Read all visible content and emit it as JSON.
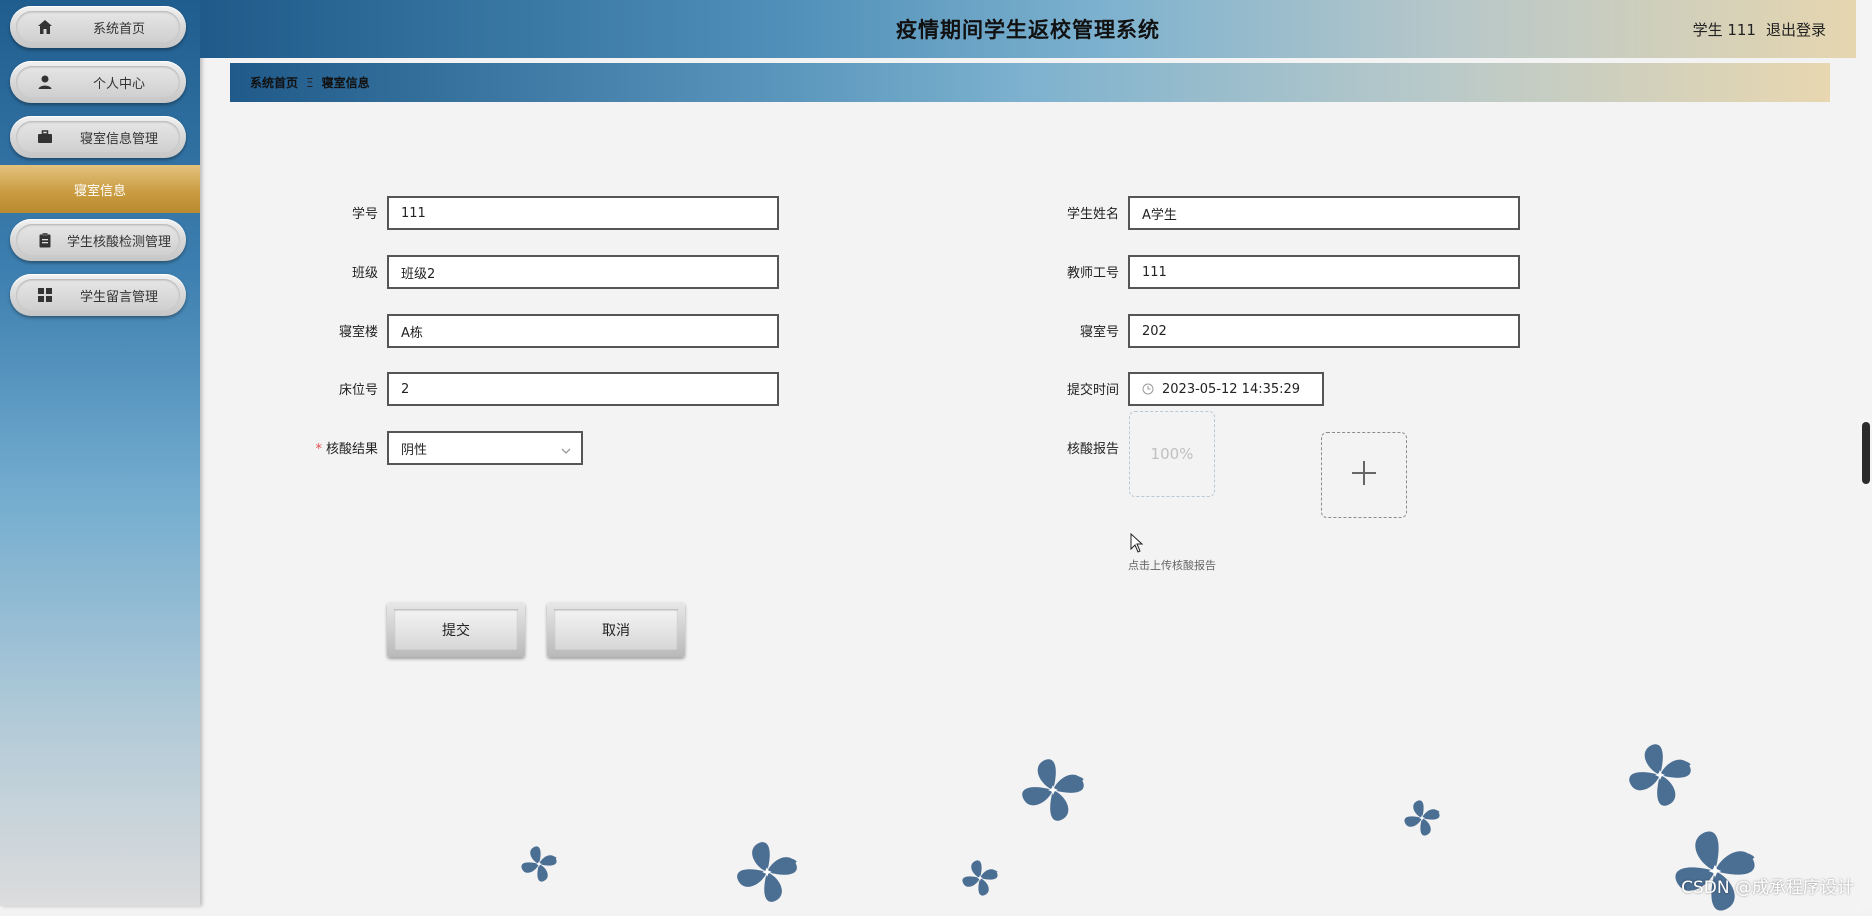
{
  "app": {
    "title": "疫情期间学生返校管理系统"
  },
  "header": {
    "user_label": "学生 111",
    "logout_label": "退出登录"
  },
  "sidebar": {
    "items": [
      {
        "label": "系统首页",
        "icon": "home-icon"
      },
      {
        "label": "个人中心",
        "icon": "user-icon"
      },
      {
        "label": "寝室信息管理",
        "icon": "briefcase-icon"
      },
      {
        "label": "学生核酸检测管理",
        "icon": "clipboard-icon"
      },
      {
        "label": "学生留言管理",
        "icon": "grid-icon"
      }
    ],
    "submenu_active": "寝室信息"
  },
  "breadcrumb": {
    "home": "系统首页",
    "separator": "Ξ",
    "current": "寝室信息"
  },
  "form": {
    "student_id": {
      "label": "学号",
      "value": "111"
    },
    "student_name": {
      "label": "学生姓名",
      "value": "A学生"
    },
    "class": {
      "label": "班级",
      "value": "班级2"
    },
    "teacher_id": {
      "label": "教师工号",
      "value": "111"
    },
    "building": {
      "label": "寝室楼",
      "value": "A栋"
    },
    "room_no": {
      "label": "寝室号",
      "value": "202"
    },
    "bed_no": {
      "label": "床位号",
      "value": "2"
    },
    "submit_time": {
      "label": "提交时间",
      "value": "2023-05-12 14:35:29"
    },
    "test_result": {
      "label": "核酸结果",
      "required_mark": "*",
      "value": "阴性"
    },
    "report": {
      "label": "核酸报告",
      "progress": "100%",
      "progress_value": 1.0,
      "hint": "点击上传核酸报告"
    }
  },
  "buttons": {
    "submit": "提交",
    "cancel": "取消"
  },
  "watermark": "CSDN @成承程序设计",
  "colors": {
    "accent_gold": "#c99a3e",
    "header_blue": "#1f5a8a",
    "required": "#e04c4c",
    "flower": "#4b6e93"
  }
}
